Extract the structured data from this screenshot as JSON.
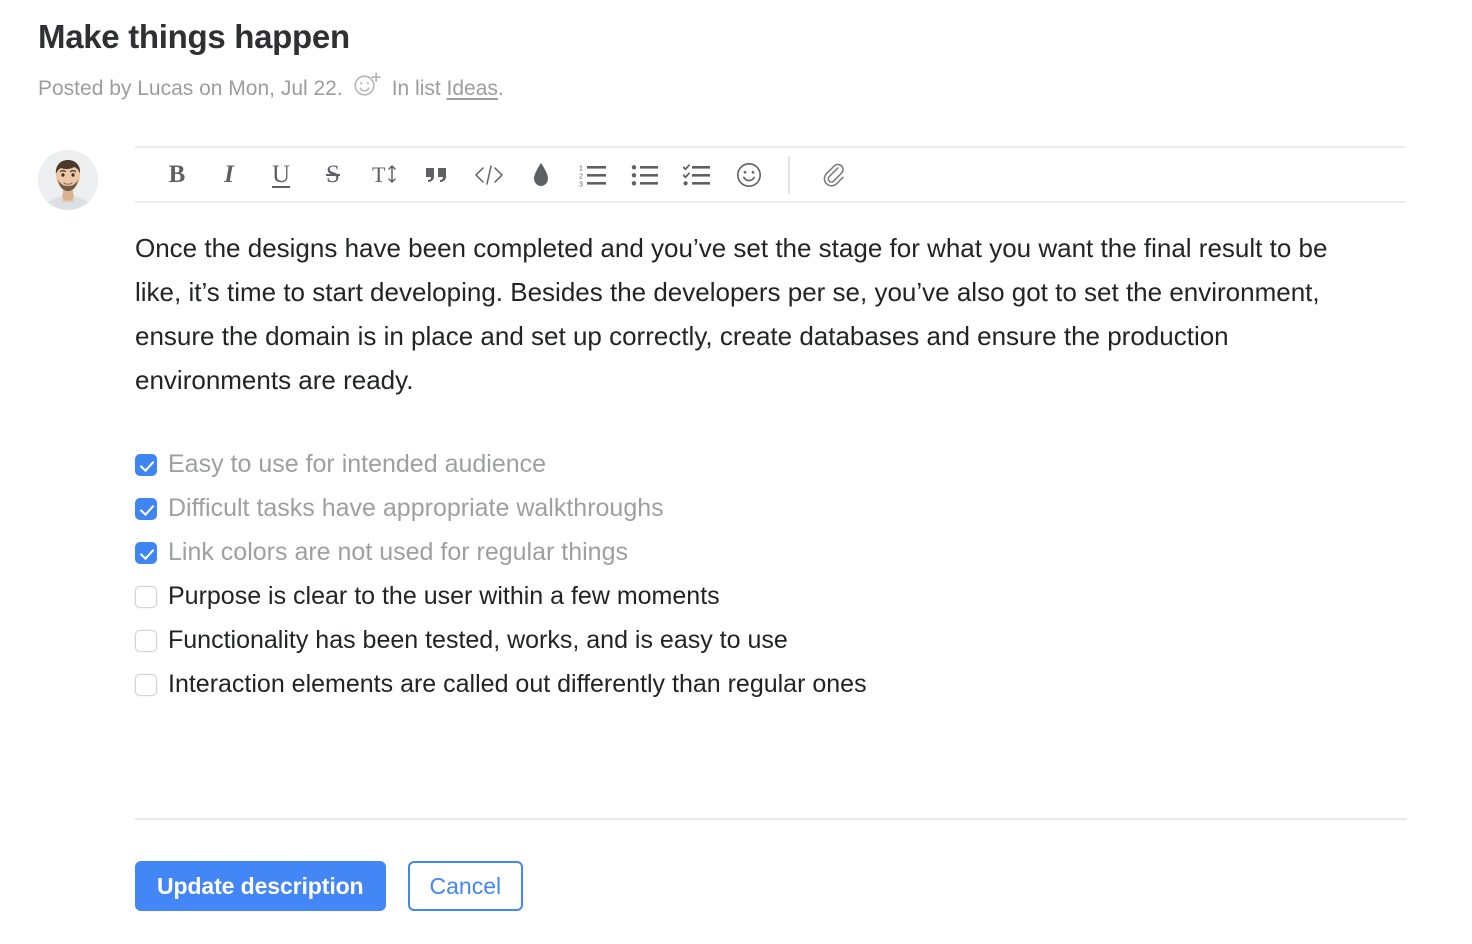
{
  "card": {
    "title": "Make things happen",
    "meta_prefix": "Posted by Lucas on Mon, Jul 22.",
    "reaction_icon": "smiley-plus-icon",
    "meta_in_list": "In list",
    "list_name": "Ideas",
    "meta_suffix": "."
  },
  "avatar": {
    "name": "user-avatar",
    "alt": "Lucas"
  },
  "toolbar": {
    "items": [
      {
        "name": "bold-icon",
        "glyph": "B",
        "style": "bold"
      },
      {
        "name": "italic-icon",
        "glyph": "I",
        "style": "italic"
      },
      {
        "name": "underline-icon",
        "glyph": "U",
        "style": "underline"
      },
      {
        "name": "strikethrough-icon",
        "glyph": "S",
        "style": "strike"
      },
      {
        "name": "text-size-icon",
        "glyph": "T",
        "style": "size"
      },
      {
        "name": "blockquote-icon",
        "glyph": "“",
        "style": "quote"
      },
      {
        "name": "code-icon",
        "glyph": "</>",
        "style": "code"
      },
      {
        "name": "highlight-icon",
        "glyph": "",
        "style": "drop"
      },
      {
        "name": "ordered-list-icon",
        "glyph": "",
        "style": "ol"
      },
      {
        "name": "bulleted-list-icon",
        "glyph": "",
        "style": "ul"
      },
      {
        "name": "checklist-icon",
        "glyph": "",
        "style": "checklist"
      },
      {
        "name": "emoji-icon",
        "glyph": "",
        "style": "smiley"
      },
      {
        "name": "attachment-icon",
        "glyph": "",
        "style": "paperclip"
      }
    ]
  },
  "editor": {
    "body": "Once the designs have been completed and you’ve set the stage for what you want the final result to be like, it’s time to start developing. Besides the developers per se, you’ve also got to set the environment, ensure the domain is in place and set up correctly, create databases and ensure the production environments are ready.",
    "checklist": [
      {
        "label": "Easy to use for intended audience",
        "checked": true
      },
      {
        "label": "Difficult tasks have appropriate walkthroughs",
        "checked": true
      },
      {
        "label": "Link colors are not used for regular things",
        "checked": true
      },
      {
        "label": "Purpose is clear to the user within a few moments",
        "checked": false
      },
      {
        "label": "Functionality has been tested, works, and is easy to use",
        "checked": false
      },
      {
        "label": "Interaction elements are called out differently than regular ones",
        "checked": false
      }
    ]
  },
  "actions": {
    "submit_label": "Update description",
    "cancel_label": "Cancel"
  },
  "colors": {
    "accent": "#4287f5",
    "checkbox_checked": "#3f86f3",
    "title": "#2f3033",
    "meta": "#9b9da0",
    "body": "#222426",
    "done_label": "#9d9fa2",
    "divider": "#e7e8e9"
  }
}
